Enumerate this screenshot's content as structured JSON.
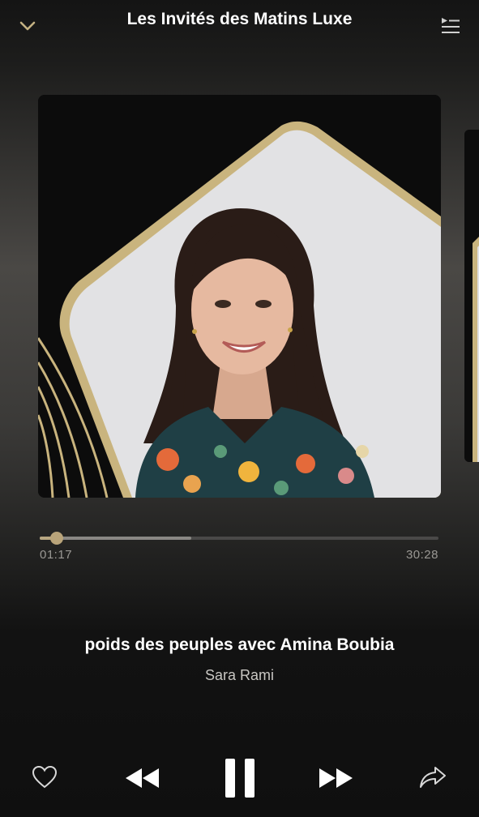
{
  "header": {
    "title": "Les Invités des Matins Luxe",
    "collapse_icon": "chevron-down-icon",
    "queue_icon": "queue-list-icon"
  },
  "artwork": {
    "description_icon": "episode-artwork"
  },
  "progress": {
    "current_time": "01:17",
    "total_time": "30:28",
    "played_fraction": 0.042,
    "buffered_fraction": 0.38
  },
  "now_playing": {
    "title": "poids des peuples avec Amina Boubia",
    "artist": "Sara Rami"
  },
  "controls": {
    "like_icon": "heart-icon",
    "rewind_icon": "rewind-icon",
    "pause_icon": "pause-icon",
    "forward_icon": "fast-forward-icon",
    "share_icon": "share-icon"
  },
  "colors": {
    "accent_gold": "#c4b182",
    "text_secondary": "#9a9894"
  }
}
